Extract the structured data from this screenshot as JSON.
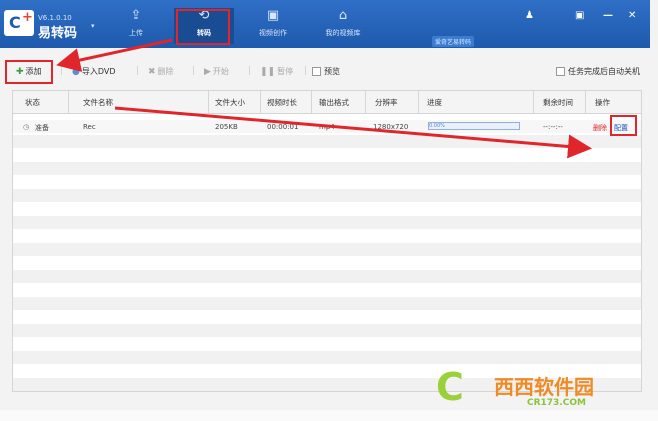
{
  "app": {
    "version": "V6.1.0.10",
    "name": "易转码",
    "dropdown": "▾"
  },
  "nav": [
    {
      "label": "上传",
      "icon": "⇪"
    },
    {
      "label": "转码",
      "icon": "⟲"
    },
    {
      "label": "视频创作",
      "icon": "▣"
    },
    {
      "label": "我的视频库",
      "icon": "⌂"
    }
  ],
  "vip_badge": "爱奇艺易转码",
  "window": {
    "user_icon": "♟",
    "msg_icon": "▣",
    "min": "—",
    "close": "✕"
  },
  "toolbar": {
    "add": "添加",
    "import_dvd": "导入DVD",
    "delete": "删除",
    "start": "开始",
    "pause": "暂停",
    "preview": "预览",
    "auto_shutdown": "任务完成后自动关机"
  },
  "table": {
    "columns": [
      "状态",
      "文件名称",
      "文件大小",
      "视频时长",
      "输出格式",
      "分辨率",
      "进度",
      "剩余时间",
      "操作"
    ],
    "rows": [
      {
        "status": "准备",
        "name": "Rec",
        "size": "205KB",
        "duration": "00:00:01",
        "format": "mp4",
        "resolution": "1280x720",
        "progress": "0.00%",
        "progress_value": 0,
        "remaining": "--:--:--",
        "op_delete": "删除",
        "op_config": "配置"
      }
    ]
  },
  "watermark": {
    "letter": "C",
    "title": "西西软件园",
    "url": "CR173.COM"
  },
  "colors": {
    "header": "#1e5aad",
    "accent_red": "#e0262a",
    "watermark_green": "#9bd03b",
    "watermark_orange": "#f08a24"
  }
}
